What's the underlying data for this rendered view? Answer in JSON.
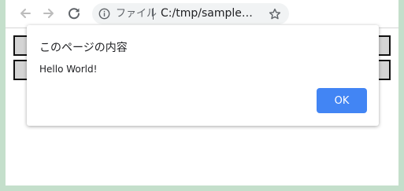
{
  "toolbar": {
    "back_icon": "arrow-left-icon",
    "forward_icon": "arrow-right-icon",
    "reload_icon": "reload-icon"
  },
  "omnibox": {
    "info_icon": "info-icon",
    "scheme_label": "ファイル",
    "url": "C:/tmp/sample…",
    "bookmark_icon": "star-outline-icon"
  },
  "dialog": {
    "title": "このページの内容",
    "message": "Hello World!",
    "ok_label": "OK"
  },
  "colors": {
    "accent": "#4285f4",
    "frame": "#c4dfcb",
    "page_box_fill": "#d4d4d4",
    "page_box_border": "#111111"
  }
}
